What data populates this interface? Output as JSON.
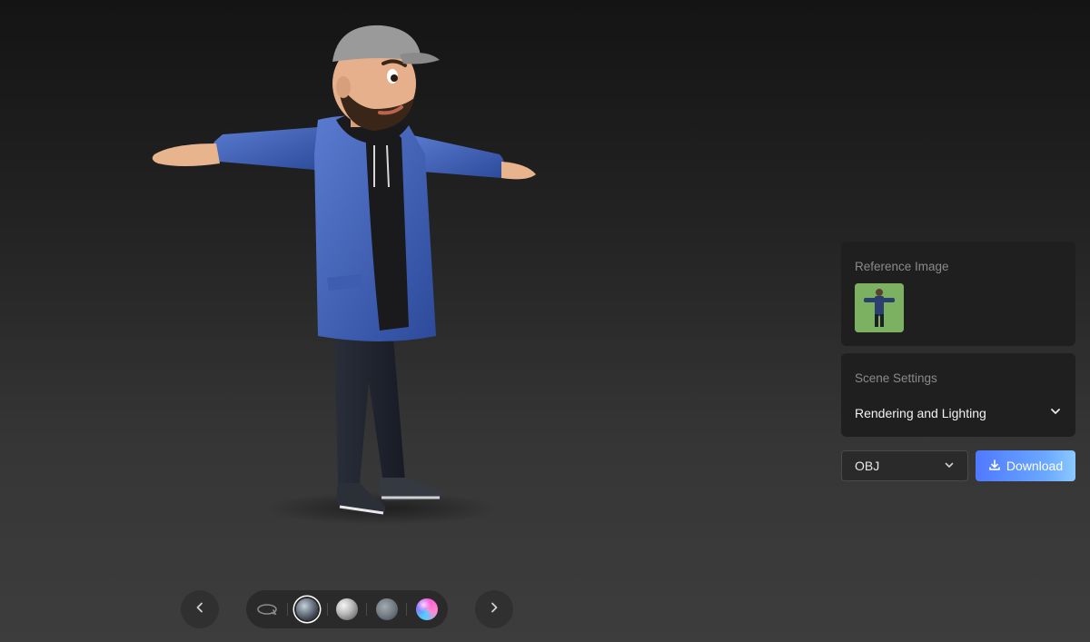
{
  "viewport": {
    "model_name": "3D character model"
  },
  "reference_panel": {
    "title": "Reference Image"
  },
  "scene_panel": {
    "title": "Scene Settings",
    "rendering_label": "Rendering and Lighting"
  },
  "export": {
    "format_value": "OBJ",
    "download_label": "Download"
  },
  "bottom_bar": {
    "prev_icon": "chevron-left-icon",
    "next_icon": "chevron-right-icon",
    "materials": [
      "rotate-icon",
      "environment-material",
      "clay-material",
      "rough-material",
      "rainbow-material"
    ],
    "selected_material": "environment-material"
  },
  "colors": {
    "panel_bg": "#1f1f1f",
    "download_gradient_start": "#4f79ff",
    "download_gradient_end": "#8cc9ff",
    "ref_thumb_bg": "#7cb162"
  }
}
